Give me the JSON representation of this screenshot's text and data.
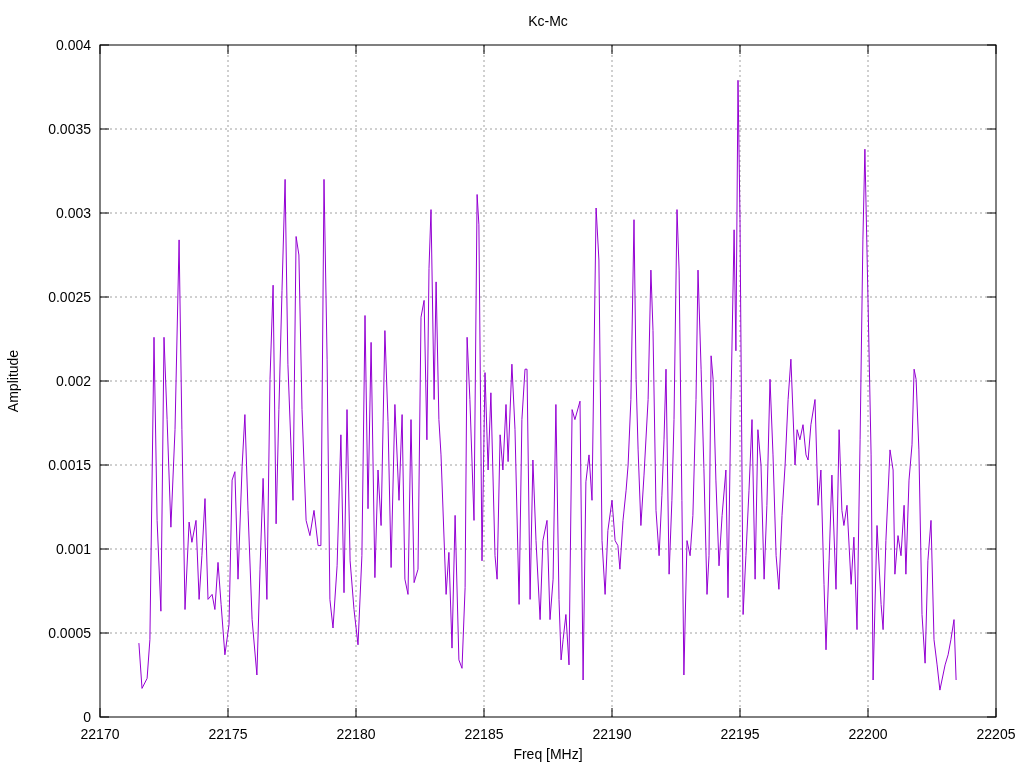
{
  "chart_data": {
    "type": "line",
    "title": "Kc-Mc",
    "xlabel": "Freq [MHz]",
    "ylabel": "Amplitude",
    "grid": true,
    "xlim": [
      22170,
      22205
    ],
    "ylim": [
      0,
      0.004
    ],
    "xticks": [
      22170,
      22175,
      22180,
      22185,
      22190,
      22195,
      22200,
      22205
    ],
    "yticks": [
      0,
      0.0005,
      0.001,
      0.0015,
      0.002,
      0.0025,
      0.003,
      0.0035,
      0.004
    ],
    "x": [
      22171.52,
      22171.64,
      22171.84,
      22171.95,
      22172.11,
      22172.23,
      22172.38,
      22172.5,
      22172.62,
      22172.77,
      22172.93,
      22173.09,
      22173.2,
      22173.32,
      22173.48,
      22173.59,
      22173.75,
      22173.87,
      22173.98,
      22174.1,
      22174.22,
      22174.38,
      22174.49,
      22174.61,
      22174.73,
      22174.88,
      22175.04,
      22175.16,
      22175.27,
      22175.39,
      22175.55,
      22175.66,
      22175.78,
      22175.94,
      22176.13,
      22176.25,
      22176.37,
      22176.52,
      22176.64,
      22176.76,
      22176.88,
      22176.99,
      22177.11,
      22177.23,
      22177.34,
      22177.54,
      22177.66,
      22177.77,
      22177.89,
      22178.05,
      22178.2,
      22178.36,
      22178.52,
      22178.63,
      22178.75,
      22178.87,
      22178.98,
      22179.1,
      22179.26,
      22179.41,
      22179.53,
      22179.65,
      22179.77,
      22179.92,
      22180.08,
      22180.23,
      22180.35,
      22180.47,
      22180.59,
      22180.74,
      22180.86,
      22180.98,
      22181.13,
      22181.25,
      22181.37,
      22181.52,
      22181.68,
      22181.8,
      22181.91,
      22182.03,
      22182.15,
      22182.27,
      22182.42,
      22182.54,
      22182.66,
      22182.77,
      22182.85,
      22182.93,
      22183.05,
      22183.13,
      22183.24,
      22183.32,
      22183.52,
      22183.63,
      22183.75,
      22183.87,
      22184.02,
      22184.14,
      22184.26,
      22184.34,
      22184.45,
      22184.61,
      22184.73,
      22184.8,
      22184.92,
      22185.04,
      22185.16,
      22185.27,
      22185.43,
      22185.51,
      22185.63,
      22185.74,
      22185.86,
      22185.94,
      22186.09,
      22186.21,
      22186.37,
      22186.48,
      22186.6,
      22186.68,
      22186.8,
      22186.91,
      22187.03,
      22187.19,
      22187.3,
      22187.46,
      22187.58,
      22187.7,
      22187.81,
      22187.93,
      22188.01,
      22188.09,
      22188.2,
      22188.32,
      22188.44,
      22188.55,
      22188.75,
      22188.87,
      22188.98,
      22189.1,
      22189.22,
      22189.38,
      22189.49,
      22189.61,
      22189.73,
      22189.84,
      22190,
      22190.12,
      22190.23,
      22190.31,
      22190.43,
      22190.55,
      22190.63,
      22190.74,
      22190.86,
      22190.94,
      22191.02,
      22191.13,
      22191.25,
      22191.41,
      22191.52,
      22191.6,
      22191.72,
      22191.84,
      22191.95,
      22192.03,
      22192.11,
      22192.23,
      22192.34,
      22192.42,
      22192.54,
      22192.62,
      22192.73,
      22192.81,
      22192.93,
      22193.05,
      22193.16,
      22193.28,
      22193.36,
      22193.48,
      22193.59,
      22193.71,
      22193.79,
      22193.87,
      22193.95,
      22194.06,
      22194.18,
      22194.3,
      22194.45,
      22194.53,
      22194.65,
      22194.77,
      22194.84,
      22194.92,
      22195,
      22195.12,
      22195.23,
      22195.35,
      22195.47,
      22195.59,
      22195.7,
      22195.82,
      22195.94,
      22196.05,
      22196.17,
      22196.29,
      22196.41,
      22196.52,
      22196.64,
      22196.76,
      22196.88,
      22196.99,
      22197.15,
      22197.23,
      22197.34,
      22197.46,
      22197.58,
      22197.66,
      22197.77,
      22197.93,
      22198.05,
      22198.16,
      22198.28,
      22198.36,
      22198.48,
      22198.59,
      22198.75,
      22198.87,
      22198.98,
      22199.06,
      22199.18,
      22199.34,
      22199.45,
      22199.57,
      22199.69,
      22199.8,
      22199.88,
      22200,
      22200.12,
      22200.2,
      22200.35,
      22200.51,
      22200.59,
      22200.7,
      22200.86,
      22200.98,
      22201.05,
      22201.17,
      22201.29,
      22201.41,
      22201.48,
      22201.6,
      22201.72,
      22201.8,
      22201.88,
      22201.99,
      22202.11,
      22202.23,
      22202.34,
      22202.46,
      22202.58,
      22202.7,
      22202.81,
      22202.93,
      22203.01,
      22203.13,
      22203.24,
      22203.36,
      22203.44
    ],
    "series": [
      {
        "color": "#9400d3",
        "values": [
          0.00044,
          0.00017,
          0.00023,
          0.00046,
          0.00226,
          0.00117,
          0.00063,
          0.00226,
          0.00177,
          0.00113,
          0.00171,
          0.00284,
          0.00171,
          0.00064,
          0.00116,
          0.00104,
          0.00117,
          0.0007,
          0.00096,
          0.0013,
          0.0007,
          0.00073,
          0.00064,
          0.00092,
          0.00067,
          0.00037,
          0.00055,
          0.00141,
          0.00146,
          0.00082,
          0.00149,
          0.0018,
          0.00123,
          0.00058,
          0.00025,
          0.00088,
          0.00142,
          0.0007,
          0.00201,
          0.00257,
          0.00115,
          0.00183,
          0.00254,
          0.0032,
          0.0021,
          0.00129,
          0.00286,
          0.00275,
          0.00183,
          0.00117,
          0.00108,
          0.00123,
          0.00102,
          0.00102,
          0.0032,
          0.00213,
          0.0007,
          0.00053,
          0.0009,
          0.00168,
          0.00074,
          0.00183,
          0.00093,
          0.00064,
          0.00043,
          0.00096,
          0.00239,
          0.00124,
          0.00223,
          0.00083,
          0.00147,
          0.00114,
          0.0023,
          0.00176,
          0.00089,
          0.00186,
          0.00129,
          0.0018,
          0.00082,
          0.00073,
          0.00177,
          0.0008,
          0.00088,
          0.00238,
          0.00248,
          0.00165,
          0.00267,
          0.00302,
          0.00189,
          0.00259,
          0.00177,
          0.00156,
          0.00073,
          0.00098,
          0.00041,
          0.0012,
          0.00034,
          0.00029,
          0.00077,
          0.00226,
          0.00189,
          0.00117,
          0.00311,
          0.00293,
          0.00093,
          0.00205,
          0.00147,
          0.00193,
          0.00096,
          0.00082,
          0.00168,
          0.00147,
          0.00186,
          0.00152,
          0.0021,
          0.00171,
          0.00067,
          0.00177,
          0.00207,
          0.00207,
          0.0007,
          0.00153,
          0.00105,
          0.00058,
          0.00105,
          0.00117,
          0.00058,
          0.00082,
          0.00186,
          0.0007,
          0.00034,
          0.00046,
          0.00061,
          0.00031,
          0.00183,
          0.00177,
          0.00188,
          0.00022,
          0.0014,
          0.00156,
          0.00129,
          0.00303,
          0.00272,
          0.00105,
          0.00073,
          0.00111,
          0.00129,
          0.00105,
          0.00102,
          0.00088,
          0.00117,
          0.00135,
          0.0015,
          0.00189,
          0.00296,
          0.00201,
          0.00159,
          0.00114,
          0.00144,
          0.00189,
          0.00266,
          0.0023,
          0.00123,
          0.00096,
          0.00132,
          0.00165,
          0.00207,
          0.00085,
          0.00129,
          0.00177,
          0.00302,
          0.00266,
          0.00129,
          0.00025,
          0.00105,
          0.00096,
          0.0012,
          0.00189,
          0.00266,
          0.00207,
          0.00148,
          0.00073,
          0.00096,
          0.00215,
          0.00201,
          0.00141,
          0.0009,
          0.0012,
          0.00147,
          0.00071,
          0.00189,
          0.0029,
          0.00218,
          0.00379,
          0.00296,
          0.00061,
          0.00096,
          0.00135,
          0.00177,
          0.00082,
          0.00171,
          0.0015,
          0.00082,
          0.00126,
          0.00201,
          0.00156,
          0.00096,
          0.00076,
          0.0012,
          0.0015,
          0.00189,
          0.00213,
          0.0015,
          0.00171,
          0.00165,
          0.00174,
          0.00156,
          0.00153,
          0.00174,
          0.00189,
          0.00126,
          0.00147,
          0.00079,
          0.0004,
          0.00093,
          0.00144,
          0.00076,
          0.00171,
          0.00123,
          0.00114,
          0.00126,
          0.00079,
          0.00107,
          0.00052,
          0.00165,
          0.00284,
          0.00338,
          0.00248,
          0.00156,
          0.00022,
          0.00114,
          0.00067,
          0.00052,
          0.00105,
          0.00159,
          0.00147,
          0.00085,
          0.00108,
          0.00096,
          0.00126,
          0.00085,
          0.00141,
          0.00162,
          0.00207,
          0.00201,
          0.00159,
          0.00061,
          0.00032,
          0.00093,
          0.00117,
          0.00046,
          0.00031,
          0.00016,
          0.00025,
          0.00031,
          0.00037,
          0.00046,
          0.00058,
          0.00022
        ]
      }
    ]
  }
}
